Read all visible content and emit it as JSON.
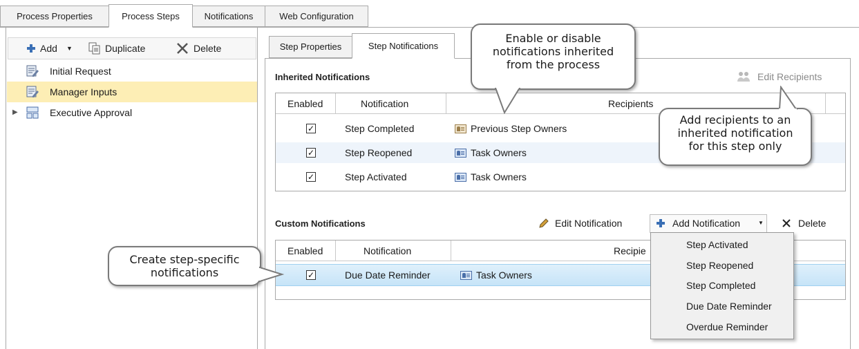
{
  "top_tabs": [
    "Process Properties",
    "Process Steps",
    "Notifications",
    "Web Configuration"
  ],
  "left_toolbar": {
    "add_label": "Add",
    "duplicate_label": "Duplicate",
    "delete_label": "Delete"
  },
  "tree": [
    {
      "label": "Initial Request"
    },
    {
      "label": "Manager Inputs"
    },
    {
      "label": "Executive Approval"
    }
  ],
  "inner_tabs": [
    "Step Properties",
    "Step Notifications"
  ],
  "inherited": {
    "title": "Inherited Notifications",
    "edit_recipients_label": "Edit Recipients",
    "columns": [
      "Enabled",
      "Notification",
      "Recipients"
    ],
    "rows": [
      {
        "enabled": true,
        "notification": "Step Completed",
        "recipients": "Previous Step Owners"
      },
      {
        "enabled": true,
        "notification": "Step Reopened",
        "recipients": "Task Owners"
      },
      {
        "enabled": true,
        "notification": "Step Activated",
        "recipients": "Task Owners"
      }
    ]
  },
  "custom": {
    "title": "Custom Notifications",
    "edit_notification_label": "Edit Notification",
    "add_notification_label": "Add Notification",
    "delete_label": "Delete",
    "columns": [
      "Enabled",
      "Notification",
      "Recipie"
    ],
    "rows": [
      {
        "enabled": true,
        "notification": "Due Date Reminder",
        "recipients": "Task Owners"
      }
    ]
  },
  "add_notification_menu": [
    "Step Activated",
    "Step Reopened",
    "Step Completed",
    "Due Date Reminder",
    "Overdue Reminder"
  ],
  "callouts": {
    "inherited": [
      "Enable or disable",
      "notifications inherited",
      "from the process"
    ],
    "recipients": [
      "Add recipients to an",
      "inherited notification",
      "for this step only"
    ],
    "custom": [
      "Create step-specific",
      "notifications"
    ]
  },
  "colors": {
    "selected_tree_row": "#fdeeb5",
    "selected_grid_row": "#c6e4f8",
    "alt_row": "#eef4fb",
    "add_icon": "#3a6fb5"
  },
  "icons": {
    "add": "plus-icon",
    "duplicate": "duplicate-icon",
    "delete": "close-x-icon",
    "edit": "pencil-icon",
    "recipients": "people-icon",
    "step": "step-edit-icon",
    "approval": "approval-icon",
    "expand": "chevron-right-icon",
    "dropdown": "chevron-down-icon"
  }
}
